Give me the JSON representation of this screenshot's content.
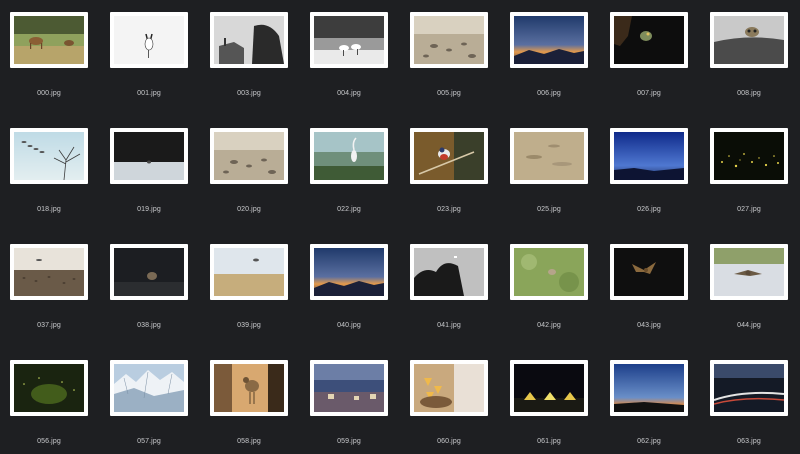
{
  "files": [
    {
      "name": "000.jpg",
      "scene": "deer-field"
    },
    {
      "name": "001.jpg",
      "scene": "cranes-white"
    },
    {
      "name": "003.jpg",
      "scene": "bw-landscape"
    },
    {
      "name": "004.jpg",
      "scene": "cranes-snow"
    },
    {
      "name": "005.jpg",
      "scene": "pebbles"
    },
    {
      "name": "006.jpg",
      "scene": "sunset-mountain"
    },
    {
      "name": "007.jpg",
      "scene": "bird-dark"
    },
    {
      "name": "008.jpg",
      "scene": "owl-rock"
    },
    {
      "name": "018.jpg",
      "scene": "birds-flying-tree"
    },
    {
      "name": "019.jpg",
      "scene": "dark-bird-snow"
    },
    {
      "name": "020.jpg",
      "scene": "pebbles"
    },
    {
      "name": "022.jpg",
      "scene": "heron-green"
    },
    {
      "name": "023.jpg",
      "scene": "robin-branch"
    },
    {
      "name": "025.jpg",
      "scene": "sand"
    },
    {
      "name": "026.jpg",
      "scene": "blue-sky"
    },
    {
      "name": "027.jpg",
      "scene": "fireflies"
    },
    {
      "name": "037.jpg",
      "scene": "field-birds"
    },
    {
      "name": "038.jpg",
      "scene": "dark-owl"
    },
    {
      "name": "039.jpg",
      "scene": "grass-bird"
    },
    {
      "name": "040.jpg",
      "scene": "sunset-mountain"
    },
    {
      "name": "041.jpg",
      "scene": "bw-forest"
    },
    {
      "name": "042.jpg",
      "scene": "green-bokeh"
    },
    {
      "name": "043.jpg",
      "scene": "dark-bird"
    },
    {
      "name": "044.jpg",
      "scene": "bird-snow-flight"
    },
    {
      "name": "056.jpg",
      "scene": "forest-glow"
    },
    {
      "name": "057.jpg",
      "scene": "snow-mountains"
    },
    {
      "name": "058.jpg",
      "scene": "bird-warm"
    },
    {
      "name": "059.jpg",
      "scene": "dusk-village"
    },
    {
      "name": "060.jpg",
      "scene": "nest-chicks"
    },
    {
      "name": "061.jpg",
      "scene": "tents-night"
    },
    {
      "name": "062.jpg",
      "scene": "blue-hour"
    },
    {
      "name": "063.jpg",
      "scene": "light-trail"
    }
  ]
}
